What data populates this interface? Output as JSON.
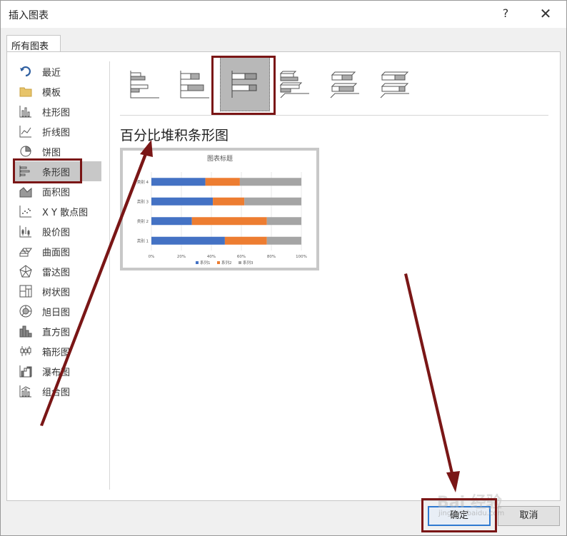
{
  "dialog": {
    "title": "插入图表",
    "help": "?",
    "close": "✕"
  },
  "tab": {
    "label": "所有图表"
  },
  "categories": [
    {
      "label": "最近",
      "icon": "undo-arrow-icon"
    },
    {
      "label": "模板",
      "icon": "folder-icon"
    },
    {
      "label": "柱形图",
      "icon": "column-chart-icon"
    },
    {
      "label": "折线图",
      "icon": "line-chart-icon"
    },
    {
      "label": "饼图",
      "icon": "pie-chart-icon"
    },
    {
      "label": "条形图",
      "icon": "bar-chart-icon",
      "selected": true
    },
    {
      "label": "面积图",
      "icon": "area-chart-icon"
    },
    {
      "label": "X Y 散点图",
      "icon": "scatter-chart-icon"
    },
    {
      "label": "股价图",
      "icon": "stock-chart-icon"
    },
    {
      "label": "曲面图",
      "icon": "surface-chart-icon"
    },
    {
      "label": "雷达图",
      "icon": "radar-chart-icon"
    },
    {
      "label": "树状图",
      "icon": "treemap-chart-icon"
    },
    {
      "label": "旭日图",
      "icon": "sunburst-chart-icon"
    },
    {
      "label": "直方图",
      "icon": "histogram-chart-icon"
    },
    {
      "label": "箱形图",
      "icon": "box-whisker-chart-icon"
    },
    {
      "label": "瀑布图",
      "icon": "waterfall-chart-icon"
    },
    {
      "label": "组合图",
      "icon": "combo-chart-icon"
    }
  ],
  "subtypes": [
    {
      "icon": "clustered-bar-icon"
    },
    {
      "icon": "stacked-bar-icon"
    },
    {
      "icon": "percent-stacked-bar-icon",
      "selected": true
    },
    {
      "icon": "3d-clustered-bar-icon"
    },
    {
      "icon": "3d-stacked-bar-icon"
    },
    {
      "icon": "3d-percent-stacked-bar-icon"
    }
  ],
  "selected_type_title": "百分比堆积条形图",
  "chart_data": {
    "type": "bar",
    "stacked": "percent",
    "title": "图表标题",
    "categories": [
      "类别 1",
      "类别 2",
      "类别 3",
      "类别 4"
    ],
    "series": [
      {
        "name": "系列1",
        "values": [
          49,
          27,
          41,
          36
        ],
        "color": "#4472c4"
      },
      {
        "name": "系列2",
        "values": [
          28,
          50,
          21,
          23
        ],
        "color": "#ed7d31"
      },
      {
        "name": "系列3",
        "values": [
          23,
          23,
          38,
          41
        ],
        "color": "#a5a5a5"
      }
    ],
    "xticks": [
      "0%",
      "20%",
      "40%",
      "60%",
      "80%",
      "100%"
    ],
    "xlim": [
      0,
      100
    ],
    "grid": true,
    "legend": "bottom"
  },
  "buttons": {
    "ok": "确定",
    "cancel": "取消"
  },
  "watermark": {
    "text": "Bai 经验",
    "sub": "jingyan.baidu.com"
  },
  "colors": {
    "highlight": "#7a1616",
    "accent": "#2f7ad1",
    "selected_bg": "#c8c8c8"
  }
}
